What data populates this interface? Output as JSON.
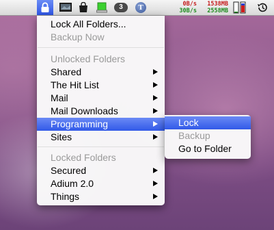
{
  "menubar": {
    "stats": {
      "up_rate": "0B/s",
      "down_rate": "30B/s",
      "mem_used": "1538MB",
      "mem_free": "2558MB"
    },
    "icons": [
      "lock-icon",
      "display-icon",
      "bag-icon",
      "battery-icon",
      "badge-count-icon",
      "tbird-icon",
      "memory-meter-icon",
      "time-machine-icon"
    ],
    "badge_count": "3",
    "tbird_letter": "T"
  },
  "main_menu": {
    "lock_all": "Lock All Folders...",
    "backup_now": "Backup Now",
    "unlocked_header": "Unlocked Folders",
    "unlocked": [
      "Shared",
      "The Hit List",
      "Mail",
      "Mail Downloads",
      "Programming",
      "Sites"
    ],
    "locked_header": "Locked Folders",
    "locked": [
      "Secured",
      "Adium 2.0",
      "Things"
    ]
  },
  "submenu": {
    "items": [
      "Lock",
      "Backup",
      "Go to Folder"
    ]
  },
  "colors": {
    "highlight": "#3159e8",
    "up_color": "#c41a1a",
    "down_color": "#1d8a1d"
  }
}
